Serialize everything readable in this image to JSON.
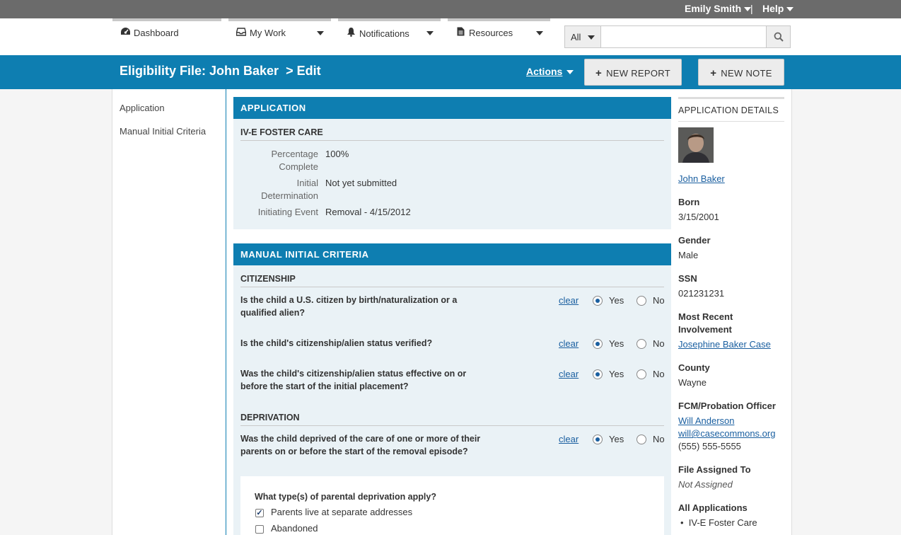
{
  "topbar": {
    "user_name": "Emily Smith",
    "separator": "|",
    "help": "Help"
  },
  "nav": {
    "items": [
      {
        "label": "Dashboard",
        "icon": "dashboard-icon"
      },
      {
        "label": "My Work",
        "icon": "inbox-icon"
      },
      {
        "label": "Notifications",
        "icon": "bell-icon"
      },
      {
        "label": "Resources",
        "icon": "document-icon"
      }
    ],
    "search": {
      "scope": "All",
      "value": "",
      "placeholder": ""
    }
  },
  "header": {
    "title": "Eligibility File: John Baker",
    "crumb": "> Edit",
    "actions": "Actions",
    "new_report": "NEW REPORT",
    "new_note": "NEW NOTE"
  },
  "sidenav": {
    "items": [
      "Application",
      "Manual Initial Criteria"
    ]
  },
  "application": {
    "heading": "APPLICATION",
    "subheading": "IV-E FOSTER CARE",
    "fields": [
      {
        "label_line1": "Percentage",
        "label_line2": "Complete",
        "value": "100%"
      },
      {
        "label_line1": "Initial",
        "label_line2": "Determination",
        "value": "Not yet submitted"
      },
      {
        "label_line1": "Initiating Event",
        "label_line2": "",
        "value": "Removal - 4/15/2012"
      }
    ]
  },
  "criteria": {
    "heading": "MANUAL INITIAL CRITERIA",
    "clear_label": "clear",
    "yes_label": "Yes",
    "no_label": "No",
    "citizenship": {
      "heading": "CITIZENSHIP",
      "questions": [
        {
          "line1": "Is the child a U.S. citizen by birth/naturalization or a",
          "line2": "qualified alien?",
          "answer": "Yes"
        },
        {
          "line1": "Is the child's citizenship/alien status verified?",
          "line2": "",
          "answer": "Yes"
        },
        {
          "line1": "Was the child's citizenship/alien status effective on or",
          "line2": "before the start of the initial placement?",
          "answer": "Yes"
        }
      ]
    },
    "deprivation": {
      "heading": "DEPRIVATION",
      "question": {
        "line1": "Was the child deprived of the care of one or more of their",
        "line2": "parents on or before the start of the removal episode?",
        "answer": "Yes"
      },
      "types_question": "What type(s) of parental deprivation apply?",
      "types": [
        {
          "label": "Parents live at separate addresses",
          "checked": true
        },
        {
          "label": "Abandoned",
          "checked": false
        }
      ]
    }
  },
  "details": {
    "heading": "APPLICATION DETAILS",
    "name": "John Baker",
    "born_label": "Born",
    "born": "3/15/2001",
    "gender_label": "Gender",
    "gender": "Male",
    "ssn_label": "SSN",
    "ssn": "021231231",
    "involvement_label_1": "Most Recent",
    "involvement_label_2": "Involvement",
    "involvement": "Josephine Baker Case",
    "county_label": "County",
    "county": "Wayne",
    "officer_label": "FCM/Probation Officer",
    "officer_name": "Will Anderson",
    "officer_email": "will@casecommons.org",
    "officer_phone": "(555) 555-5555",
    "assigned_label": "File Assigned To",
    "assigned": "Not Assigned",
    "all_apps_label": "All Applications",
    "all_apps": [
      "IV-E Foster Care"
    ]
  }
}
